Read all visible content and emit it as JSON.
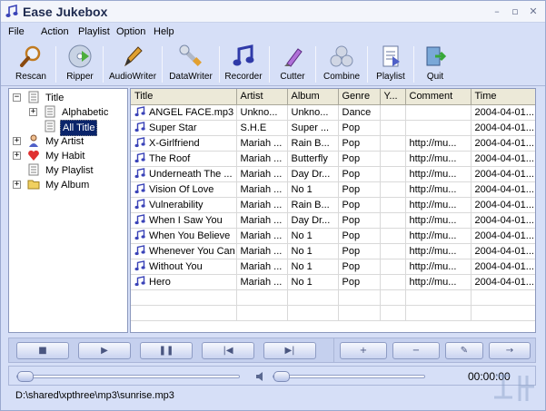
{
  "window": {
    "title": "Ease Jukebox",
    "controls": [
      "minimize",
      "restore",
      "close"
    ],
    "minimize_glyph": "–",
    "restore_glyph": "▫",
    "close_glyph": "✕",
    "icon": "music-note-icon"
  },
  "menubar": {
    "items": [
      "File",
      "Action",
      "Playlist",
      "Option",
      "Help"
    ]
  },
  "toolbar": {
    "buttons": [
      {
        "label": "Rescan",
        "icon": "magnifier-icon"
      },
      {
        "label": "Ripper",
        "icon": "disc-ripper-icon"
      },
      {
        "label": "AudioWriter",
        "icon": "pen-icon"
      },
      {
        "label": "DataWriter",
        "icon": "wrench-icon"
      },
      {
        "label": "Recorder",
        "icon": "music-note-icon"
      },
      {
        "label": "Cutter",
        "icon": "cutter-icon"
      },
      {
        "label": "Combine",
        "icon": "combine-icon"
      },
      {
        "label": "Playlist",
        "icon": "playlist-icon"
      },
      {
        "label": "Quit",
        "icon": "quit-icon"
      }
    ]
  },
  "tree": {
    "items": [
      {
        "label": "Title",
        "expander": "−",
        "icon": "document-icon"
      },
      {
        "label": "Alphabetic",
        "expander": "+",
        "icon": "document-icon"
      },
      {
        "label": "All Title",
        "expander": "",
        "icon": "document-icon",
        "selected": true
      },
      {
        "label": "My Artist",
        "expander": "+",
        "icon": "person-icon"
      },
      {
        "label": "My Habit",
        "expander": "+",
        "icon": "heart-icon"
      },
      {
        "label": "My Playlist",
        "expander": "",
        "icon": "document-icon"
      },
      {
        "label": "My Album",
        "expander": "+",
        "icon": "folder-icon"
      }
    ]
  },
  "table": {
    "columns": [
      "Title",
      "Artist",
      "Album",
      "Genre",
      "Y...",
      "Comment",
      "Time"
    ],
    "rows": [
      [
        "ANGEL FACE.mp3",
        "Unkno...",
        "Unkno...",
        "Dance",
        "",
        "",
        "2004-04-01..."
      ],
      [
        "Super Star",
        "S.H.E",
        "Super ...",
        "Pop",
        "",
        "",
        "2004-04-01..."
      ],
      [
        "X-Girlfriend",
        "Mariah ...",
        "Rain B...",
        "Pop",
        "",
        "http://mu...",
        "2004-04-01..."
      ],
      [
        "The Roof",
        "Mariah ...",
        "Butterfly",
        "Pop",
        "",
        "http://mu...",
        "2004-04-01..."
      ],
      [
        "Underneath The ...",
        "Mariah ...",
        "Day Dr...",
        "Pop",
        "",
        "http://mu...",
        "2004-04-01..."
      ],
      [
        "Vision Of Love",
        "Mariah ...",
        "No 1",
        "Pop",
        "",
        "http://mu...",
        "2004-04-01..."
      ],
      [
        "Vulnerability",
        "Mariah ...",
        "Rain B...",
        "Pop",
        "",
        "http://mu...",
        "2004-04-01..."
      ],
      [
        "When I Saw You",
        "Mariah ...",
        "Day Dr...",
        "Pop",
        "",
        "http://mu...",
        "2004-04-01..."
      ],
      [
        "When You Believe",
        "Mariah ...",
        "No 1",
        "Pop",
        "",
        "http://mu...",
        "2004-04-01..."
      ],
      [
        "Whenever You Can",
        "Mariah ...",
        "No 1",
        "Pop",
        "",
        "http://mu...",
        "2004-04-01..."
      ],
      [
        "Without You",
        "Mariah ...",
        "No 1",
        "Pop",
        "",
        "http://mu...",
        "2004-04-01..."
      ],
      [
        "Hero",
        "Mariah ...",
        "No 1",
        "Pop",
        "",
        "http://mu...",
        "2004-04-01..."
      ]
    ]
  },
  "player": {
    "buttons": [
      {
        "name": "stop-button",
        "glyph": "■",
        "icon": "stop-icon"
      },
      {
        "name": "play-button",
        "glyph": "▶",
        "icon": "play-icon"
      },
      {
        "name": "pause-button",
        "glyph": "❚❚",
        "icon": "pause-icon"
      },
      {
        "name": "previous-button",
        "glyph": "|◀",
        "icon": "previous-icon"
      },
      {
        "name": "next-button",
        "glyph": "▶|",
        "icon": "next-icon"
      },
      {
        "name": "add-button",
        "glyph": "+",
        "icon": "plus-icon"
      },
      {
        "name": "remove-button",
        "glyph": "−",
        "icon": "minus-icon"
      },
      {
        "name": "edit-button",
        "glyph": "✎",
        "icon": "edit-icon"
      },
      {
        "name": "forward-button",
        "glyph": "→",
        "icon": "arrow-right-icon"
      }
    ],
    "seek_position": 0,
    "volume_level": 0,
    "time": "00:00:00"
  },
  "status": {
    "path": "D:\\shared\\xpthree\\mp3\\sunrise.mp3"
  },
  "colors": {
    "chrome": "#d6dff7",
    "selection": "#0a246a",
    "accent_icon": "#5058c8"
  }
}
